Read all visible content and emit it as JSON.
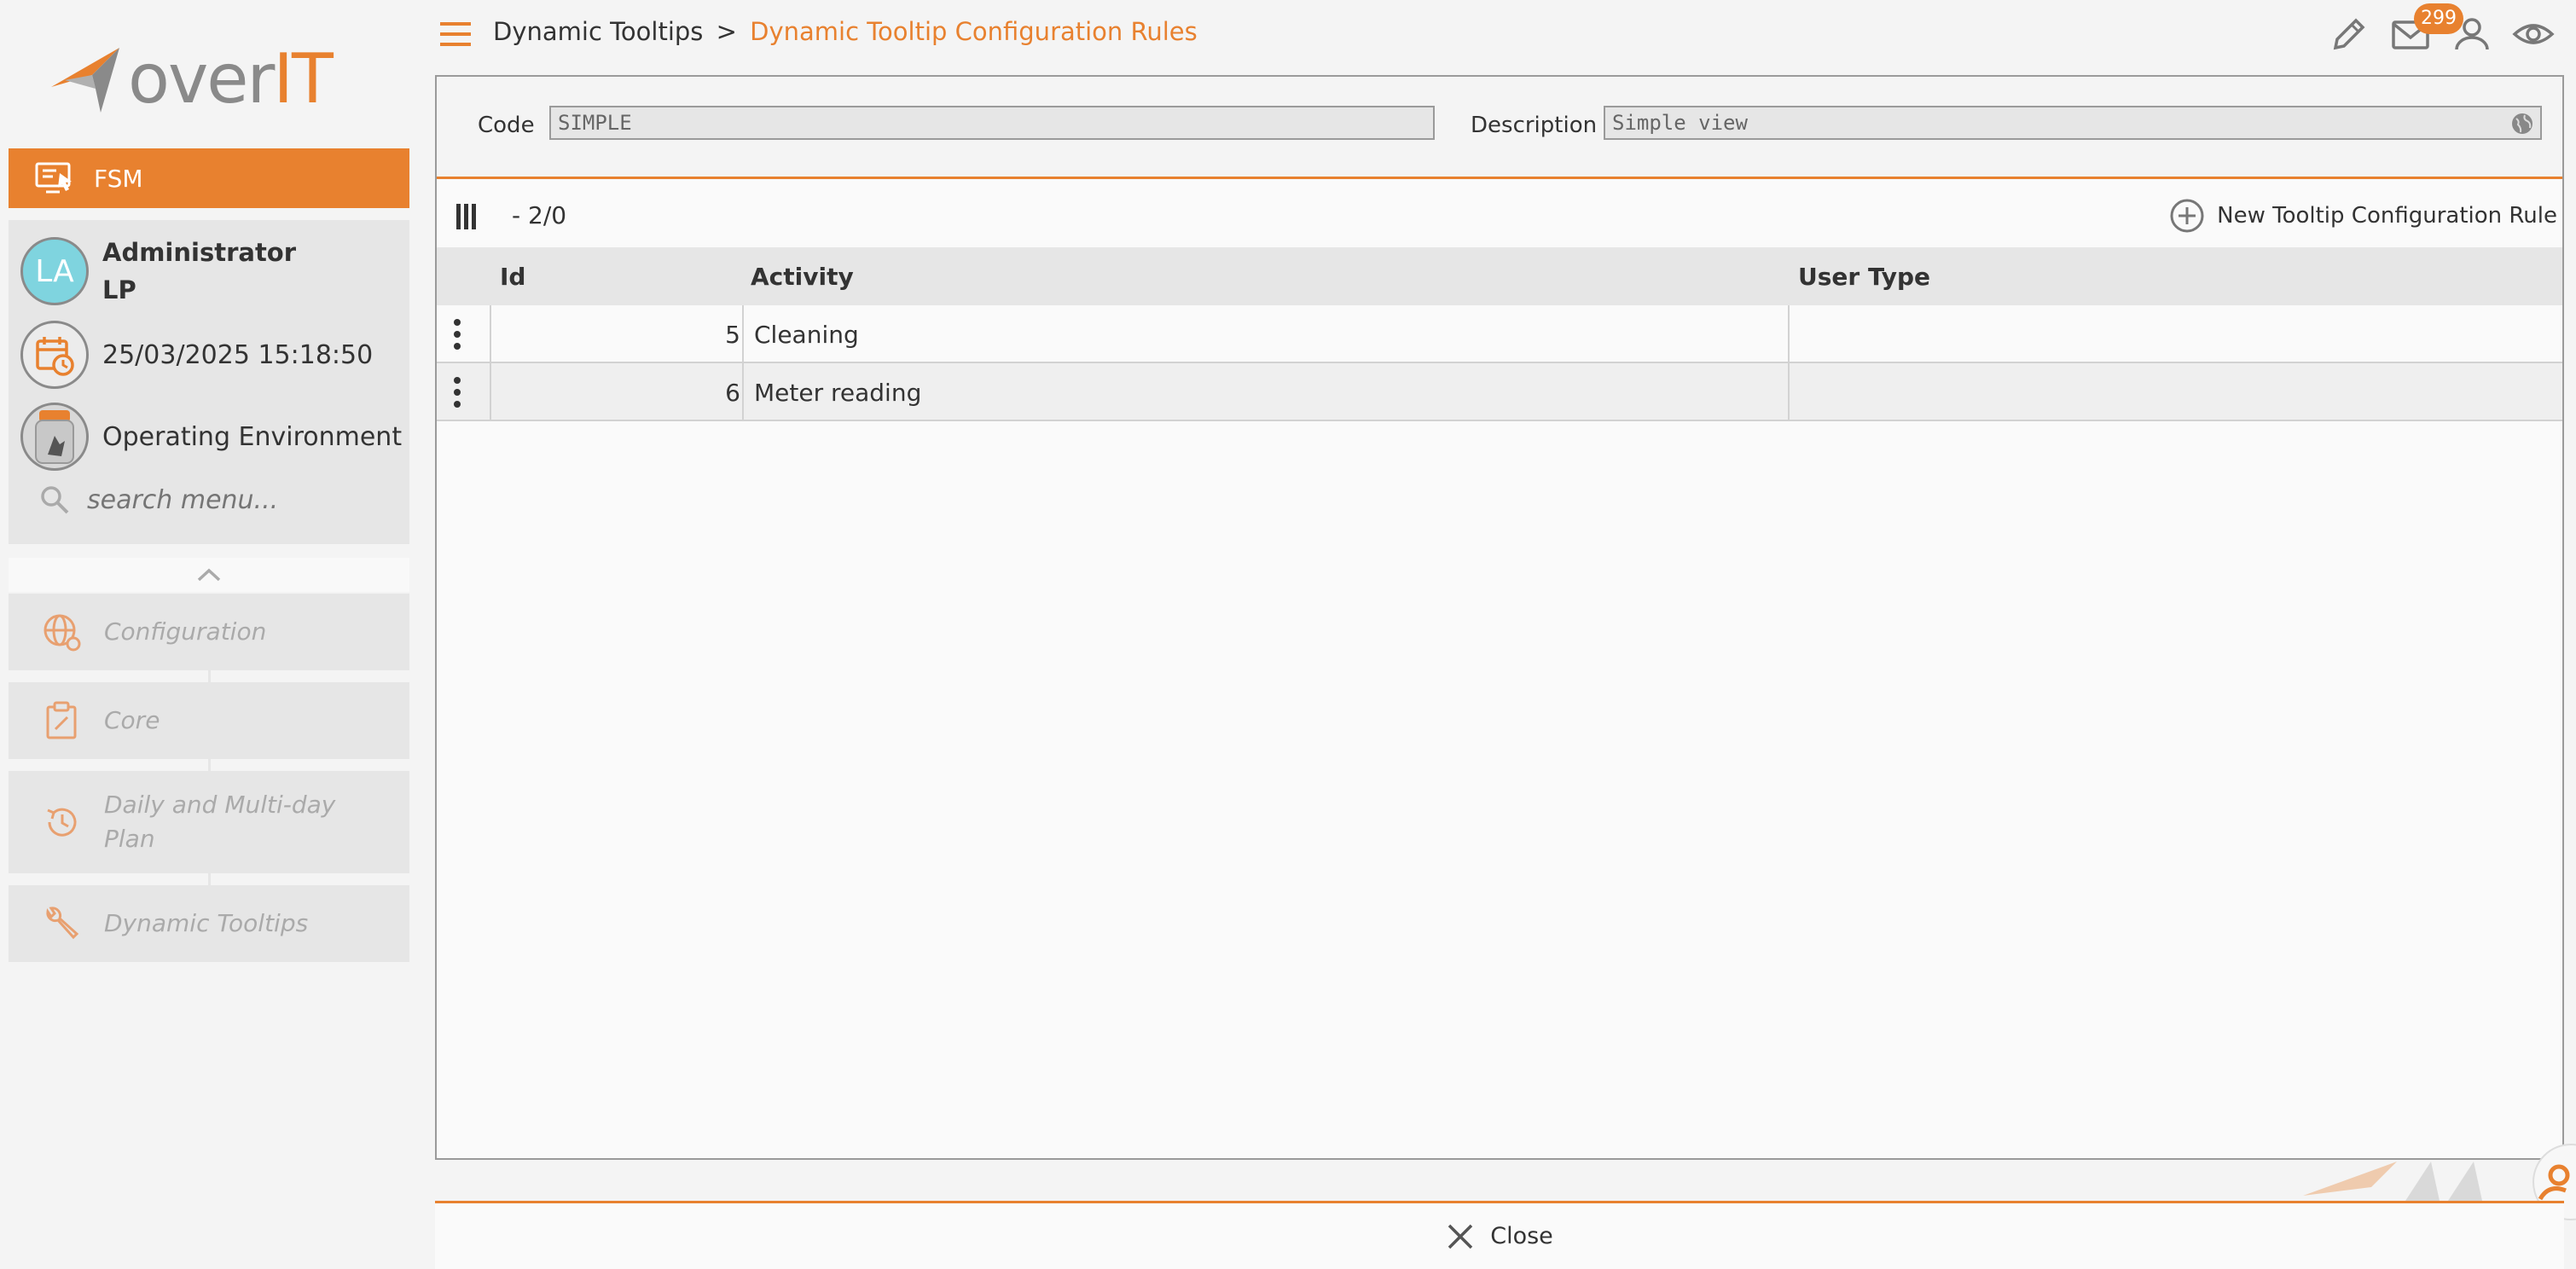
{
  "brand": {
    "logo_over": "over",
    "logo_it": "IT",
    "accent": "#e8812f"
  },
  "sidebar": {
    "module": "FSM",
    "user": {
      "initials": "LA",
      "name": "Administrator",
      "surname": "LP"
    },
    "datetime": "25/03/2025 15:18:50",
    "environment": "Operating Environment",
    "search_placeholder": "search menu...",
    "items": [
      {
        "label": "Configuration",
        "icon": "globe-gear-icon"
      },
      {
        "label": "Core",
        "icon": "clipboard-edit-icon"
      },
      {
        "label": "Daily and Multi-day Plan",
        "icon": "history-icon"
      },
      {
        "label": "Dynamic Tooltips",
        "icon": "wrench-icon"
      }
    ]
  },
  "header": {
    "breadcrumb_parent": "Dynamic Tooltips",
    "breadcrumb_sep": ">",
    "breadcrumb_current": "Dynamic Tooltip Configuration Rules",
    "mail_count": "299"
  },
  "form": {
    "code_label": "Code",
    "code_value": "SIMPLE",
    "description_label": "Description",
    "description_value": "Simple view"
  },
  "toolbar": {
    "counter": "- 2/0",
    "new_label": "New Tooltip Configuration Rule"
  },
  "table": {
    "columns": [
      "Id",
      "Activity",
      "User Type"
    ],
    "rows": [
      {
        "id": "5",
        "activity": "Cleaning",
        "user_type": ""
      },
      {
        "id": "6",
        "activity": "Meter reading",
        "user_type": ""
      }
    ]
  },
  "footer": {
    "close_label": "Close"
  }
}
